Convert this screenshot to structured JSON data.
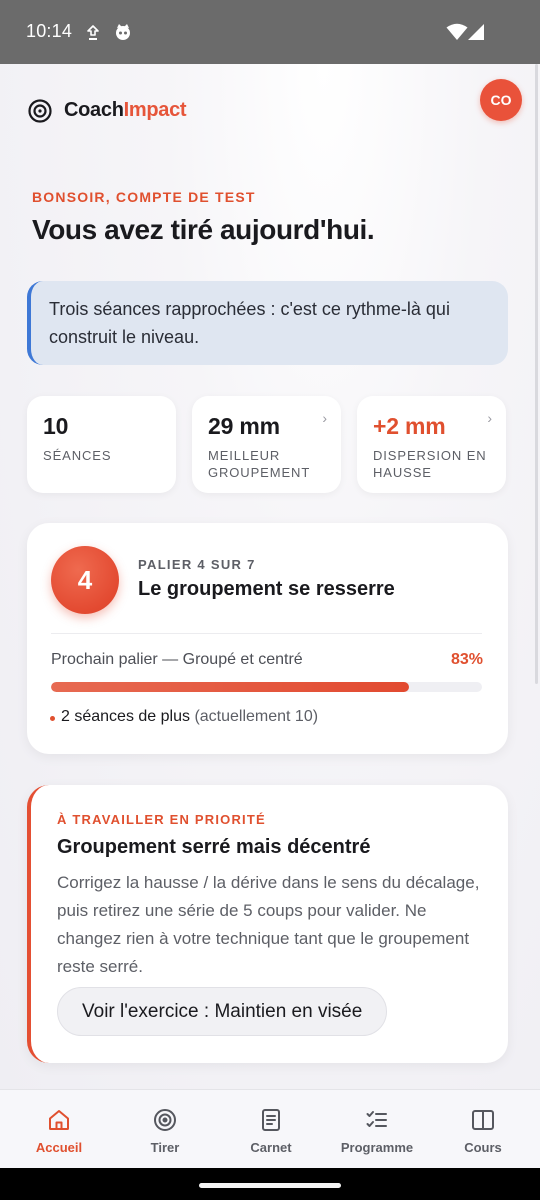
{
  "status_bar": {
    "time": "10:14"
  },
  "header": {
    "brand_part1": "Coach",
    "brand_part2": "Impact",
    "avatar_initials": "CO"
  },
  "greeting": {
    "kicker": "BONSOIR, COMPTE DE TEST",
    "headline": "Vous avez tiré aujourd'hui."
  },
  "tip": {
    "text": "Trois séances rapprochées : c'est ce rythme-là qui construit le niveau."
  },
  "stats": [
    {
      "value": "10",
      "label": "Séances",
      "chevron": ""
    },
    {
      "value": "29 mm",
      "label": "Meilleur groupement",
      "chevron": "›"
    },
    {
      "value": "+2 mm",
      "label": "Dispersion en hausse",
      "chevron": "›"
    }
  ],
  "level": {
    "number": "4",
    "kicker": "PALIER 4 SUR 7",
    "title": "Le groupement se resserre",
    "progress_label": "Prochain palier — Groupé et centré",
    "progress_percent_text": "83%",
    "progress_fraction": 0.83,
    "note_main": "2 séances de plus",
    "note_muted": "(actuellement 10)"
  },
  "priority": {
    "kicker": "À TRAVAILLER EN PRIORITÉ",
    "title": "Groupement serré mais décentré",
    "body": "Corrigez la hausse / la dérive dans le sens du décalage, puis retirez une série de 5 coups pour valider. Ne changez rien à votre technique tant que le groupement reste serré.",
    "button": "Voir l'exercice : Maintien en visée"
  },
  "tabs": [
    {
      "label": "Accueil",
      "icon": "home-icon",
      "active": true
    },
    {
      "label": "Tirer",
      "icon": "target-icon",
      "active": false
    },
    {
      "label": "Carnet",
      "icon": "notebook-icon",
      "active": false
    },
    {
      "label": "Programme",
      "icon": "checklist-icon",
      "active": false
    },
    {
      "label": "Cours",
      "icon": "book-icon",
      "active": false
    }
  ],
  "colors": {
    "accent": "#e0502f",
    "tip_border": "#3e78d6",
    "tip_background": "#dfe6f1"
  }
}
